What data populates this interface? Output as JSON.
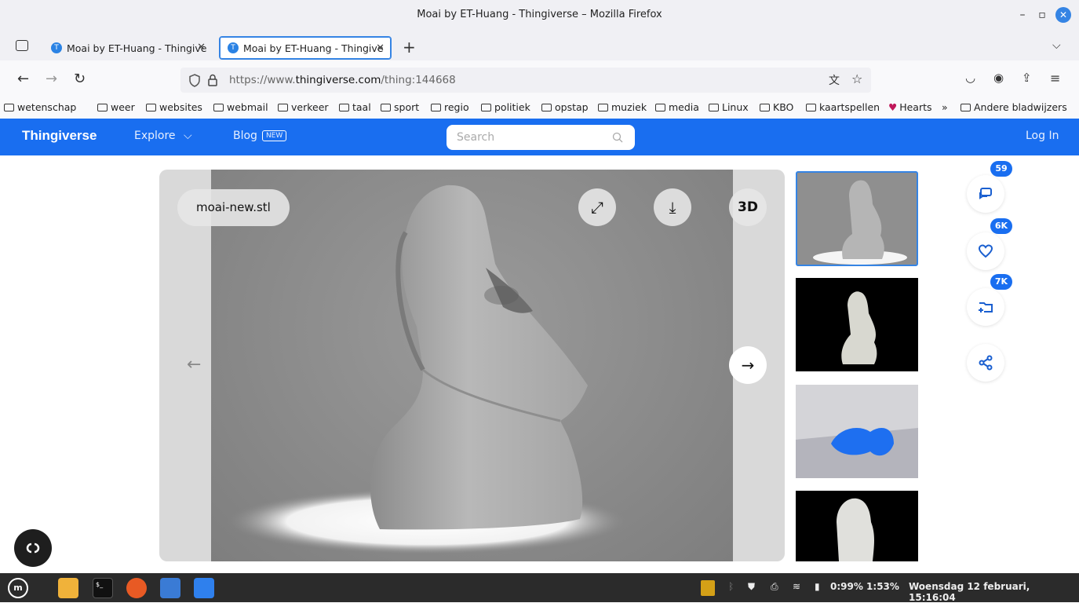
{
  "window": {
    "title": "Moai by ET-Huang - Thingiverse – Mozilla Firefox"
  },
  "tabs": [
    {
      "label": "Moai by ET-Huang - Thingive"
    },
    {
      "label": "Moai by ET-Huang - Thingive"
    }
  ],
  "urlbar": {
    "prefix": "https://www.",
    "domain": "thingiverse.com",
    "path": "/thing:144668"
  },
  "bookmarks": [
    "wetenschap",
    "weer",
    "websites",
    "webmail",
    "verkeer",
    "taal",
    "sport",
    "regio",
    "politiek",
    "opstap",
    "muziek",
    "media",
    "Linux",
    "KBO",
    "kaartspellen",
    "Hearts",
    "Andere bladwijzers"
  ],
  "site": {
    "logo": "Thingiverse",
    "explore": "Explore",
    "blog": "Blog",
    "blog_badge": "NEW",
    "search_placeholder": "Search",
    "login": "Log In"
  },
  "viewer": {
    "filename": "moai-new.stl",
    "btn_3d": "3D"
  },
  "counts": {
    "comments": "59",
    "likes": "6K",
    "collections": "7K"
  },
  "taskbar": {
    "status": "0:99% 1:53%",
    "datetime": "Woensdag 12 februari, 15:16:04"
  },
  "colors": {
    "brand": "#196ef0",
    "accent": "#3584e4"
  }
}
